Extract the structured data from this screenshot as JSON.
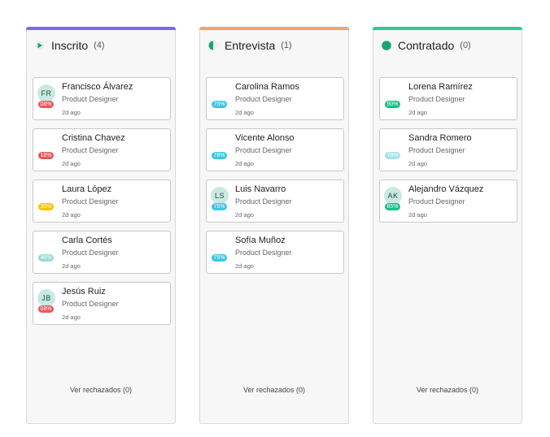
{
  "colors": {
    "col_inscrito": "#8268e5",
    "col_entrevista": "#f2a470",
    "col_contratado": "#27cf96",
    "score_red": "#e5585a",
    "score_yellow": "#f7c400",
    "score_light_teal": "#9bdbd3",
    "score_cyan": "#38c8e4",
    "score_green": "#18bf86",
    "score_light_cyan": "#a6e0ea"
  },
  "columns": [
    {
      "title": "Inscrito",
      "count": "(4)",
      "icon": "play-icon",
      "rejected_label": "Ver rechazados (0)",
      "cards": [
        {
          "name": "Francisco Álvarez",
          "role": "Product Designer",
          "time": "2d ago",
          "initials": "FR",
          "score": "08%",
          "score_color": "red"
        },
        {
          "name": "Cristina Chavez",
          "role": "Product Designer",
          "time": "2d ago",
          "initials": "",
          "score": "18%",
          "score_color": "red"
        },
        {
          "name": "Laura López",
          "role": "Product Designer",
          "time": "2d ago",
          "initials": "",
          "score": "30%",
          "score_color": "yellow"
        },
        {
          "name": "Carla Cortés",
          "role": "Product Designer",
          "time": "2d ago",
          "initials": "",
          "score": "46%",
          "score_color": "light_teal"
        },
        {
          "name": "Jesús Ruiz",
          "role": "Product Designer",
          "time": "2d ago",
          "initials": "JB",
          "score": "08%",
          "score_color": "red"
        }
      ]
    },
    {
      "title": "Entrevista",
      "count": "(1)",
      "icon": "half-circle-icon",
      "rejected_label": "Ver rechazados (0)",
      "cards": [
        {
          "name": "Carolina Ramos",
          "role": "Product Designer",
          "time": "2d ago",
          "initials": "",
          "score": "75%",
          "score_color": "cyan"
        },
        {
          "name": "Vicente Alonso",
          "role": "Product Designer",
          "time": "2d ago",
          "initials": "",
          "score": "78%",
          "score_color": "cyan"
        },
        {
          "name": "Luis Navarro",
          "role": "Product Designer",
          "time": "2d ago",
          "initials": "LS",
          "score": "75%",
          "score_color": "cyan"
        },
        {
          "name": "Sofía Muñoz",
          "role": "Product Designer",
          "time": "2d ago",
          "initials": "",
          "score": "75%",
          "score_color": "cyan"
        }
      ]
    },
    {
      "title": "Contratado",
      "count": "(0)",
      "icon": "filled-circle-icon",
      "rejected_label": "Ver rechazados (0)",
      "cards": [
        {
          "name": "Lorena Ramírez",
          "role": "Product Designer",
          "time": "2d ago",
          "initials": "",
          "score": "90%",
          "score_color": "green"
        },
        {
          "name": "Sandra Romero",
          "role": "Product Designer",
          "time": "2d ago",
          "initials": "",
          "score": "78%",
          "score_color": "light_cyan"
        },
        {
          "name": "Alejandro Vázquez",
          "role": "Product Designer",
          "time": "2d ago",
          "initials": "AK",
          "score": "85%",
          "score_color": "green"
        }
      ]
    }
  ]
}
